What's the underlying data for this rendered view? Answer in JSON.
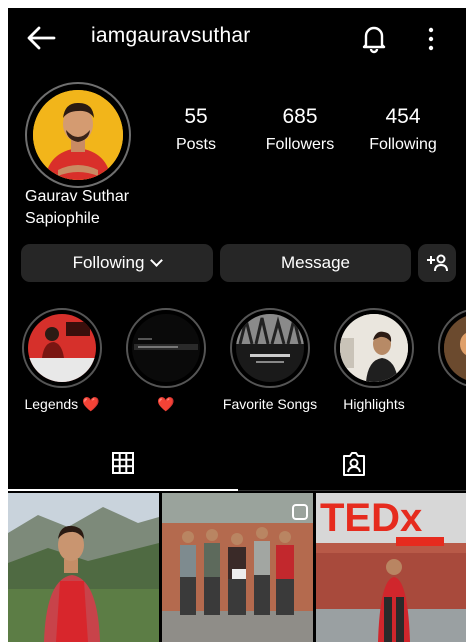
{
  "header": {
    "username": "iamgauravsuthar",
    "back_icon": "arrow-left-icon",
    "notification_icon": "bell-icon",
    "more_icon": "more-vertical-icon"
  },
  "profile": {
    "name": "Gaurav Suthar",
    "bio": "Sapiophile",
    "stats": [
      {
        "value": "55",
        "label": "Posts"
      },
      {
        "value": "685",
        "label": "Followers"
      },
      {
        "value": "454",
        "label": "Following"
      }
    ]
  },
  "actions": {
    "following": "Following",
    "message": "Message",
    "add_user_icon": "add-person-icon"
  },
  "highlights": [
    {
      "label": "Legends ❤️"
    },
    {
      "label": "❤️"
    },
    {
      "label": "Favorite Songs"
    },
    {
      "label": "Highlights"
    },
    {
      "label": ""
    }
  ],
  "tabs": {
    "grid_icon": "grid-icon",
    "tagged_icon": "tagged-person-icon"
  },
  "posts": [
    {
      "description": "photo"
    },
    {
      "description": "photo"
    },
    {
      "description": "photo"
    }
  ]
}
